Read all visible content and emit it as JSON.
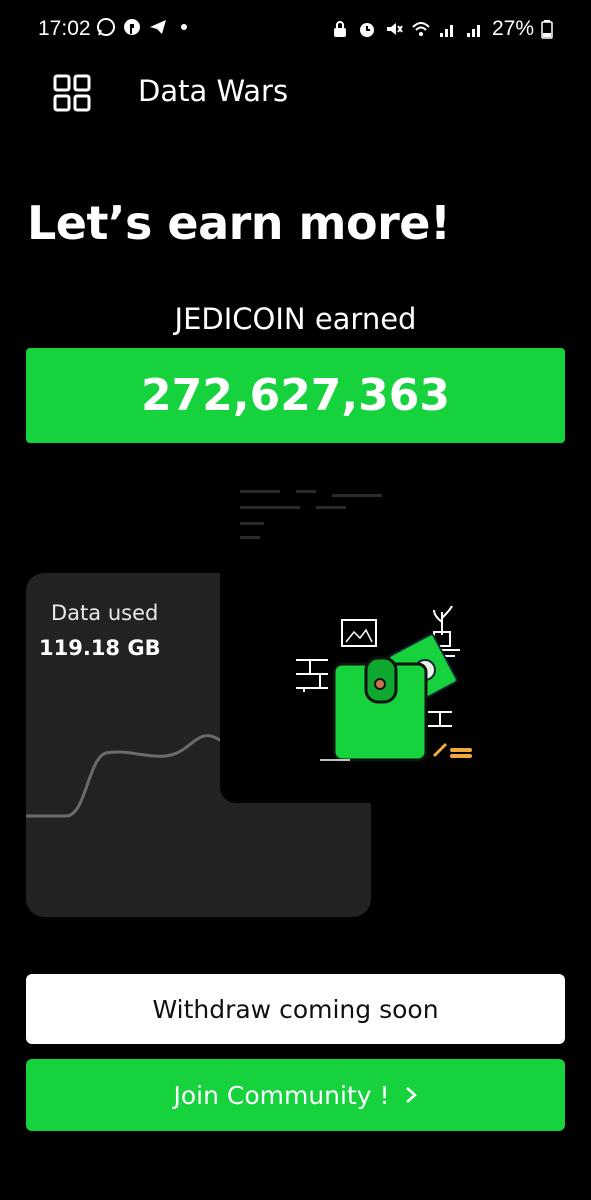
{
  "status_bar": {
    "time": "17:02",
    "battery_percent": "27%",
    "left_icons": [
      "whatsapp-icon",
      "messenger-icon",
      "telegram-icon",
      "notification-dot-icon"
    ],
    "right_icons": [
      "lock-icon",
      "alarm-icon",
      "mute-icon",
      "wifi-icon",
      "signal-icon",
      "signal-icon",
      "battery-icon"
    ]
  },
  "header": {
    "title": "Data Wars",
    "menu_icon": "grid-icon"
  },
  "main": {
    "headline": "Let’s earn more!",
    "earned_label": "JEDICOIN earned",
    "earned_value": "272,627,363"
  },
  "data_card": {
    "label": "Data used",
    "value": "119.18 GB"
  },
  "buttons": {
    "withdraw_label": "Withdraw coming soon",
    "join_label": "Join Community !"
  },
  "colors": {
    "accent": "#16d23d",
    "background": "#000000",
    "card": "#222222"
  }
}
